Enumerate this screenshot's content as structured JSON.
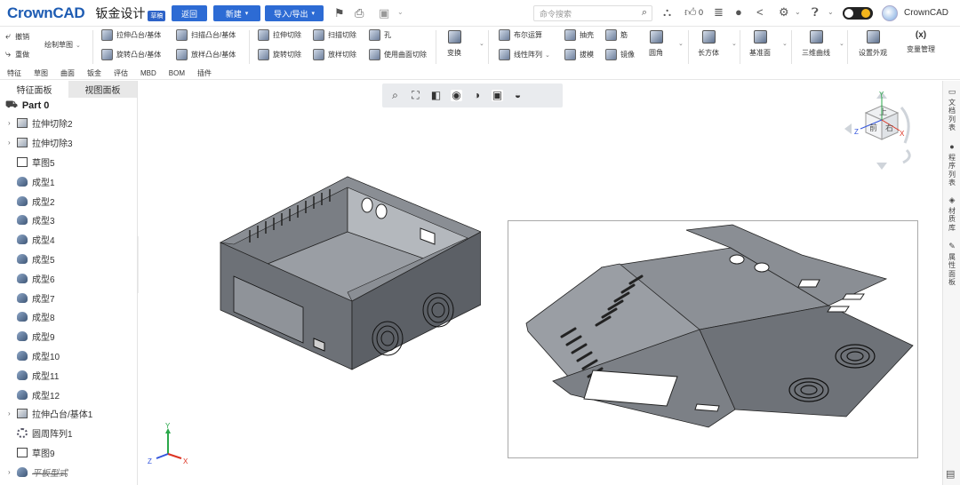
{
  "topbar": {
    "logo": "CrownCAD",
    "doc_title": "钣金设计",
    "doc_badge": "草稿",
    "return_label": "返回",
    "new_label": "新建",
    "import_export_label": "导入/导出",
    "search_placeholder": "命令搜索",
    "like_count": "0",
    "user_name": "CrownCAD"
  },
  "ribbon": {
    "undo": "撤销",
    "redo": "重做",
    "sketch": "绘制草图",
    "extrude_boss": "拉伸凸台/基体",
    "sweep_boss": "扫描凸台/基体",
    "revolve_boss": "旋转凸台/基体",
    "loft_boss": "放样凸台/基体",
    "extrude_cut": "拉伸切除",
    "sweep_cut": "扫描切除",
    "hole": "孔",
    "revolve_cut": "旋转切除",
    "loft_cut": "放样切除",
    "surface_cut": "使用曲面切除",
    "transform": "变换",
    "boolean": "布尔运算",
    "shell": "抽壳",
    "rib": "筋",
    "linear_pattern": "线性阵列",
    "draft": "拔模",
    "mirror": "镜像",
    "fillet": "圆角",
    "box": "长方体",
    "ref_plane": "基准面",
    "curve3d": "三维曲线",
    "appearance": "设置外观",
    "variables": "变量管理"
  },
  "menu_tabs": [
    "特征",
    "草图",
    "曲面",
    "钣金",
    "评估",
    "MBD",
    "BOM",
    "插件"
  ],
  "left_panel": {
    "tab_feature": "特征面板",
    "tab_view": "视图面板",
    "root": "Part 0",
    "items": [
      {
        "label": "拉伸切除2",
        "expand": true,
        "icon": "box"
      },
      {
        "label": "拉伸切除3",
        "expand": true,
        "icon": "box"
      },
      {
        "label": "草图5",
        "expand": false,
        "icon": "sketch"
      },
      {
        "label": "成型1",
        "expand": false,
        "icon": "form"
      },
      {
        "label": "成型2",
        "expand": false,
        "icon": "form"
      },
      {
        "label": "成型3",
        "expand": false,
        "icon": "form"
      },
      {
        "label": "成型4",
        "expand": false,
        "icon": "form"
      },
      {
        "label": "成型5",
        "expand": false,
        "icon": "form"
      },
      {
        "label": "成型6",
        "expand": false,
        "icon": "form"
      },
      {
        "label": "成型7",
        "expand": false,
        "icon": "form"
      },
      {
        "label": "成型8",
        "expand": false,
        "icon": "form"
      },
      {
        "label": "成型9",
        "expand": false,
        "icon": "form"
      },
      {
        "label": "成型10",
        "expand": false,
        "icon": "form"
      },
      {
        "label": "成型11",
        "expand": false,
        "icon": "form"
      },
      {
        "label": "成型12",
        "expand": false,
        "icon": "form"
      },
      {
        "label": "拉伸凸台/基体1",
        "expand": true,
        "icon": "box"
      },
      {
        "label": "圆周阵列1",
        "expand": false,
        "icon": "pattern"
      },
      {
        "label": "草图9",
        "expand": false,
        "icon": "sketch"
      },
      {
        "label": "平板型式",
        "expand": true,
        "icon": "form",
        "suppressed": true
      }
    ]
  },
  "viewcube": {
    "front": "前",
    "top": "上",
    "right": "右",
    "axis_x": "X",
    "axis_y": "Y",
    "axis_z": "Z"
  },
  "triad": {
    "x": "X",
    "y": "Y",
    "z": "Z"
  },
  "right_strip": [
    "文档列表",
    "程序列表",
    "材质库",
    "属性面板"
  ],
  "colors": {
    "accent": "#2d6bd4",
    "logo": "#1e5cb3"
  }
}
